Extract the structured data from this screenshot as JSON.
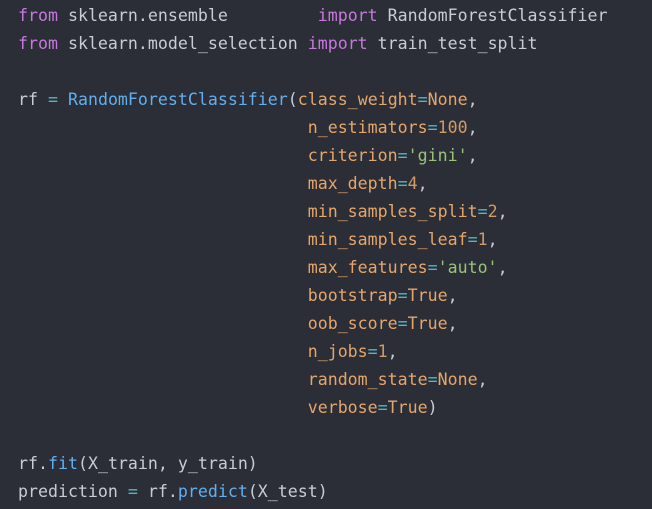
{
  "colors": {
    "background": "#2b2e36",
    "keyword": "#c678dd",
    "function": "#61afef",
    "operator": "#56b6c2",
    "parameter": "#e5a66b",
    "string": "#98c379",
    "number": "#d19a66",
    "identifier": "#c8ccd4"
  },
  "lines": [
    [
      {
        "t": "from",
        "c": "kw"
      },
      {
        "t": " sklearn.ensemble         ",
        "c": "id"
      },
      {
        "t": "import",
        "c": "kw"
      },
      {
        "t": " RandomForestClassifier",
        "c": "id"
      }
    ],
    [
      {
        "t": "from",
        "c": "kw"
      },
      {
        "t": " sklearn.model_selection ",
        "c": "id"
      },
      {
        "t": "import",
        "c": "kw"
      },
      {
        "t": " train_test_split",
        "c": "id"
      }
    ],
    [],
    [
      {
        "t": "rf ",
        "c": "id"
      },
      {
        "t": "=",
        "c": "op"
      },
      {
        "t": " ",
        "c": "id"
      },
      {
        "t": "RandomForestClassifier",
        "c": "fn"
      },
      {
        "t": "(",
        "c": "punct"
      },
      {
        "t": "class_weight",
        "c": "param"
      },
      {
        "t": "=",
        "c": "op"
      },
      {
        "t": "None",
        "c": "param"
      },
      {
        "t": ",",
        "c": "punct"
      }
    ],
    [
      {
        "t": "                             ",
        "c": "id"
      },
      {
        "t": "n_estimators",
        "c": "param"
      },
      {
        "t": "=",
        "c": "op"
      },
      {
        "t": "100",
        "c": "num"
      },
      {
        "t": ",",
        "c": "punct"
      }
    ],
    [
      {
        "t": "                             ",
        "c": "id"
      },
      {
        "t": "criterion",
        "c": "param"
      },
      {
        "t": "=",
        "c": "op"
      },
      {
        "t": "'gini'",
        "c": "str"
      },
      {
        "t": ",",
        "c": "punct"
      }
    ],
    [
      {
        "t": "                             ",
        "c": "id"
      },
      {
        "t": "max_depth",
        "c": "param"
      },
      {
        "t": "=",
        "c": "op"
      },
      {
        "t": "4",
        "c": "num"
      },
      {
        "t": ",",
        "c": "punct"
      }
    ],
    [
      {
        "t": "                             ",
        "c": "id"
      },
      {
        "t": "min_samples_split",
        "c": "param"
      },
      {
        "t": "=",
        "c": "op"
      },
      {
        "t": "2",
        "c": "num"
      },
      {
        "t": ",",
        "c": "punct"
      }
    ],
    [
      {
        "t": "                             ",
        "c": "id"
      },
      {
        "t": "min_samples_leaf",
        "c": "param"
      },
      {
        "t": "=",
        "c": "op"
      },
      {
        "t": "1",
        "c": "num"
      },
      {
        "t": ",",
        "c": "punct"
      }
    ],
    [
      {
        "t": "                             ",
        "c": "id"
      },
      {
        "t": "max_features",
        "c": "param"
      },
      {
        "t": "=",
        "c": "op"
      },
      {
        "t": "'auto'",
        "c": "str"
      },
      {
        "t": ",",
        "c": "punct"
      }
    ],
    [
      {
        "t": "                             ",
        "c": "id"
      },
      {
        "t": "bootstrap",
        "c": "param"
      },
      {
        "t": "=",
        "c": "op"
      },
      {
        "t": "True",
        "c": "param"
      },
      {
        "t": ",",
        "c": "punct"
      }
    ],
    [
      {
        "t": "                             ",
        "c": "id"
      },
      {
        "t": "oob_score",
        "c": "param"
      },
      {
        "t": "=",
        "c": "op"
      },
      {
        "t": "True",
        "c": "param"
      },
      {
        "t": ",",
        "c": "punct"
      }
    ],
    [
      {
        "t": "                             ",
        "c": "id"
      },
      {
        "t": "n_jobs",
        "c": "param"
      },
      {
        "t": "=",
        "c": "op"
      },
      {
        "t": "1",
        "c": "num"
      },
      {
        "t": ",",
        "c": "punct"
      }
    ],
    [
      {
        "t": "                             ",
        "c": "id"
      },
      {
        "t": "random_state",
        "c": "param"
      },
      {
        "t": "=",
        "c": "op"
      },
      {
        "t": "None",
        "c": "param"
      },
      {
        "t": ",",
        "c": "punct"
      }
    ],
    [
      {
        "t": "                             ",
        "c": "id"
      },
      {
        "t": "verbose",
        "c": "param"
      },
      {
        "t": "=",
        "c": "op"
      },
      {
        "t": "True",
        "c": "param"
      },
      {
        "t": ")",
        "c": "punct"
      }
    ],
    [],
    [
      {
        "t": "rf.",
        "c": "id"
      },
      {
        "t": "fit",
        "c": "fn"
      },
      {
        "t": "(X_train, y_train)",
        "c": "punct"
      }
    ],
    [
      {
        "t": "prediction ",
        "c": "id"
      },
      {
        "t": "=",
        "c": "op"
      },
      {
        "t": " rf.",
        "c": "id"
      },
      {
        "t": "predict",
        "c": "fn"
      },
      {
        "t": "(X_test)",
        "c": "punct"
      }
    ]
  ]
}
